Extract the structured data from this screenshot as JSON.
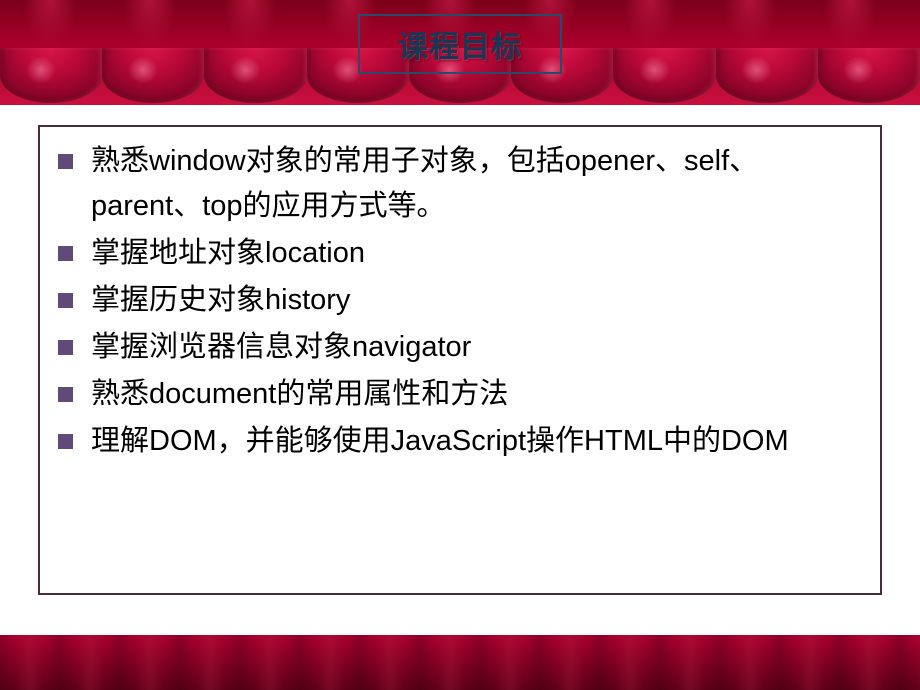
{
  "title": "课程目标",
  "bullets": [
    "熟悉window对象的常用子对象，包括opener、self、parent、top的应用方式等。",
    "掌握地址对象location",
    "掌握历史对象history",
    "掌握浏览器信息对象navigator",
    "熟悉document的常用属性和方法",
    "理解DOM，并能够使用JavaScript操作HTML中的DOM"
  ]
}
